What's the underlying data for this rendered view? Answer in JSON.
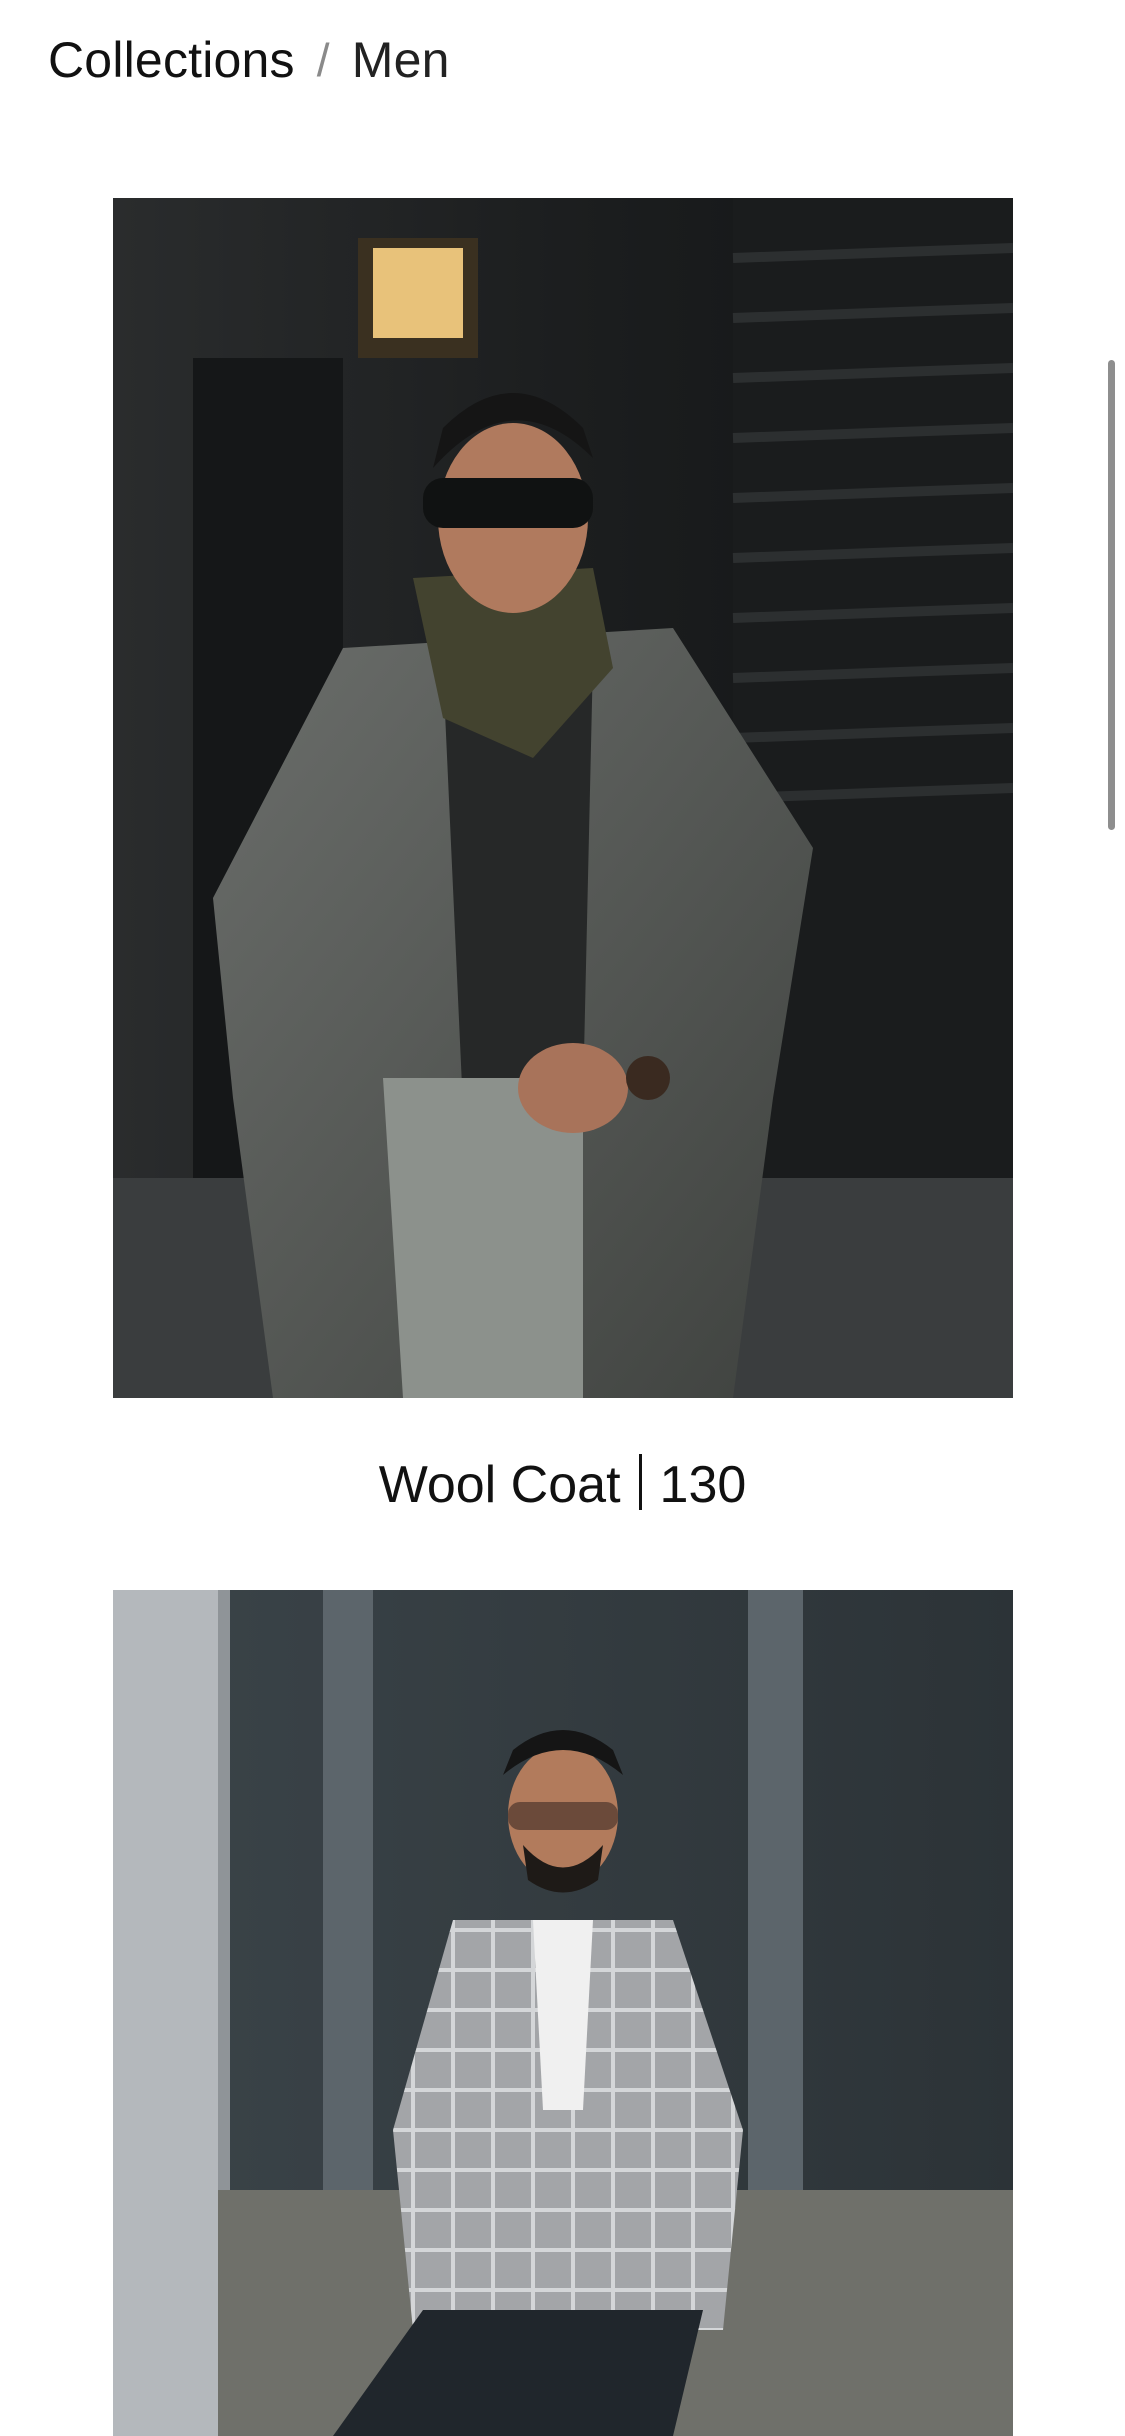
{
  "breadcrumb": {
    "parent": "Collections",
    "separator": "/",
    "current": "Men"
  },
  "products": [
    {
      "name": "Wool Coat",
      "price": "130",
      "image_alt": "Man in grey wool overcoat, dark shirt, olive scarf and sunglasses standing by a dark wooden storefront"
    },
    {
      "image_alt": "Man in grey plaid blazer, white shirt and sunglasses posing in front of a grey building"
    }
  ],
  "colors": {
    "background": "#ffffff",
    "text": "#111111",
    "scrollbar": "#8e8e8e"
  }
}
